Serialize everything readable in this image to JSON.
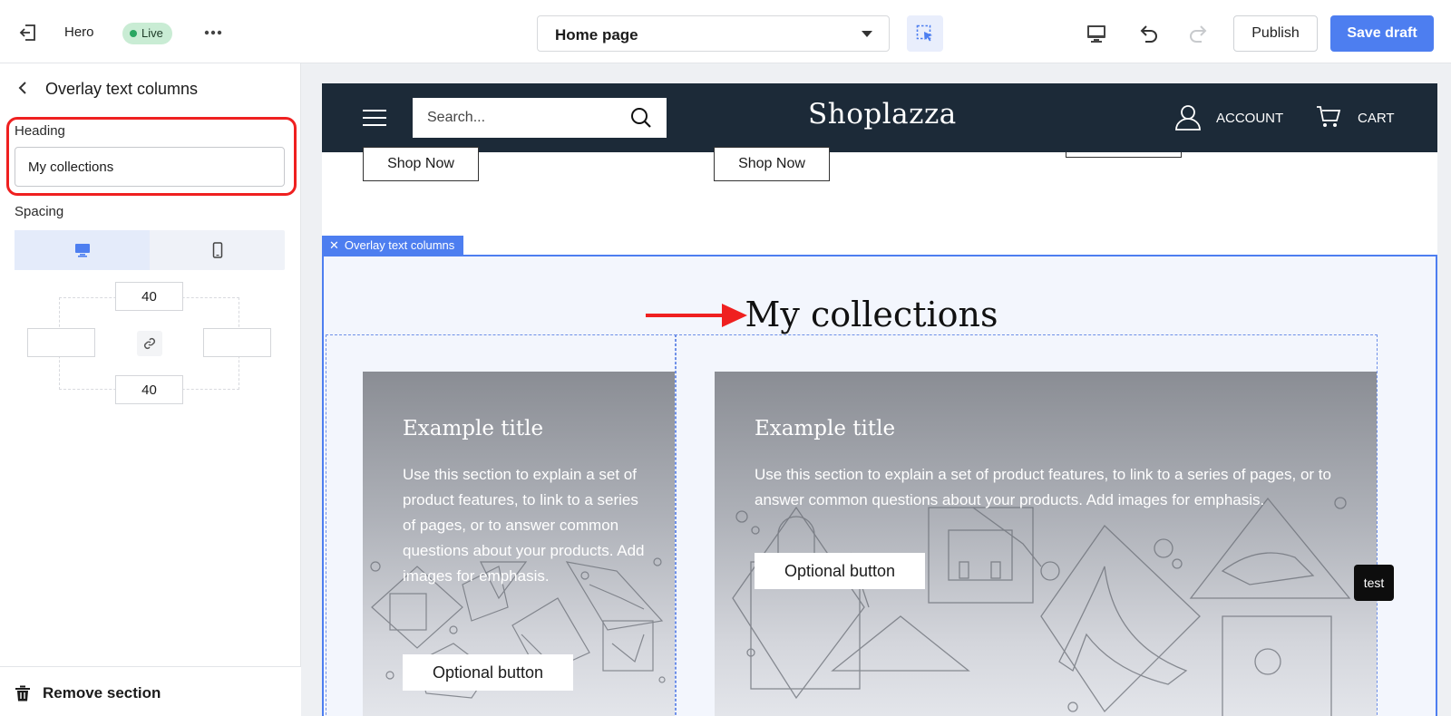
{
  "topbar": {
    "theme_name": "Hero",
    "status_badge": "Live",
    "page_select": "Home page",
    "publish_label": "Publish",
    "save_label": "Save draft"
  },
  "panel": {
    "title": "Overlay text columns",
    "heading_label": "Heading",
    "heading_value": "My collections",
    "spacing_label": "Spacing",
    "spacing": {
      "top": "40",
      "bottom": "40",
      "left": "",
      "right": ""
    },
    "remove_label": "Remove section"
  },
  "store": {
    "search_placeholder": "Search...",
    "logo": "Shoplazza",
    "account_label": "ACCOUNT",
    "cart_label": "CART",
    "shop_now_label": "Shop Now"
  },
  "section": {
    "tag": "Overlay text columns",
    "heading": "My collections",
    "cards": [
      {
        "title": "Example title",
        "text": "Use this section to explain a set of product features, to link to a series of pages, or to answer common questions about your products. Add images for emphasis.",
        "button": "Optional button"
      },
      {
        "title": "Example title",
        "text": "Use this section to explain a set of product features, to link to a series of pages, or to answer common questions about your products. Add images for emphasis.",
        "button": "Optional button"
      }
    ]
  },
  "badge": "test",
  "colors": {
    "accent": "#4d7ef0",
    "highlight": "#ef2020",
    "store_header": "#1c2a38",
    "live_badge": "#c9ecd4"
  },
  "icons": [
    "exit-icon",
    "more-icon",
    "caret-down-icon",
    "element-picker-icon",
    "desktop-icon",
    "undo-icon",
    "redo-icon",
    "back-chevron-icon",
    "mobile-icon",
    "link-icon",
    "trash-icon",
    "menu-icon",
    "search-icon",
    "account-icon",
    "cart-icon",
    "close-icon",
    "arrow-icon"
  ]
}
